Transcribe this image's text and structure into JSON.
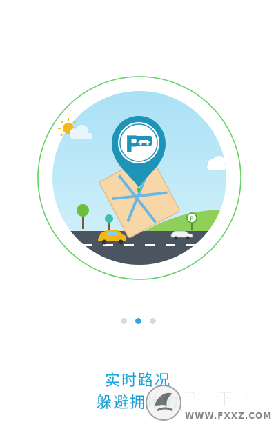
{
  "onboarding": {
    "title": "实时路况",
    "subtitle": "躲避拥堵的",
    "page_indicator": {
      "total": 3,
      "current": 2
    },
    "illustration_icons": [
      "sun-icon",
      "cloud-icon",
      "parking-location-pin-icon",
      "city-map-icon",
      "tree-icon",
      "yellow-taxi-icon",
      "white-car-icon",
      "parking-sign-icon"
    ]
  },
  "watermark": {
    "brand": "飞翔下载",
    "url": "WWW.FXXZ.COM"
  },
  "colors": {
    "accent": "#1da1d6",
    "ring": "#5fd35f",
    "sky": "#bfe9f7",
    "road": "#4a5560",
    "pin": "#1d94b8"
  }
}
